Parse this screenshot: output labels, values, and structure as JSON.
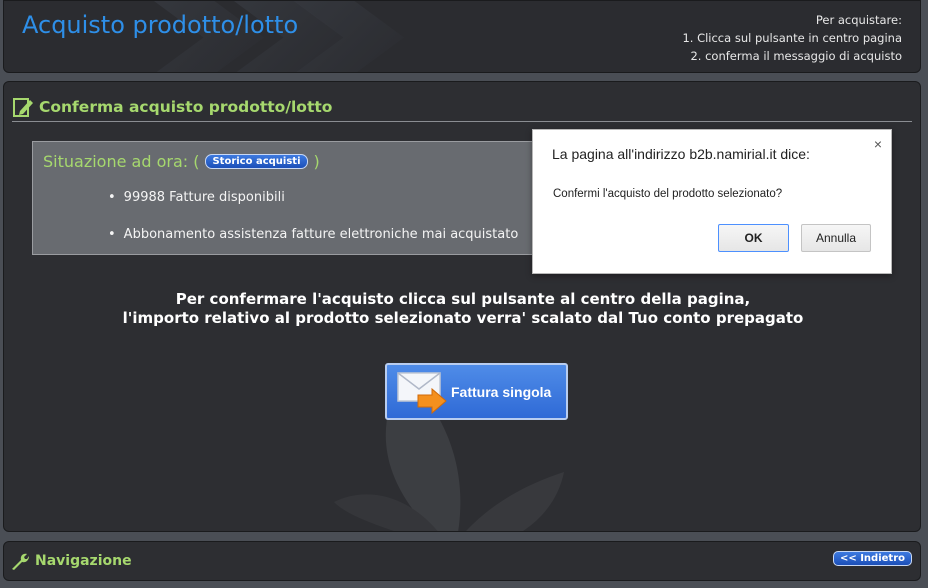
{
  "header": {
    "title": "Acquisto prodotto/lotto",
    "instructions_title": "Per acquistare:",
    "instruction_1": "1. Clicca sul pulsante in centro pagina",
    "instruction_2": "2. conferma il messaggio di acquisto"
  },
  "section": {
    "title": "Conferma acquisto prodotto/lotto",
    "icon": "edit-document-icon"
  },
  "status": {
    "title_prefix": "Situazione ad ora: (",
    "history_button": "Storico acquisti",
    "title_suffix": ")",
    "items": [
      "99988 Fatture disponibili",
      "Abbonamento assistenza fatture elettroniche mai acquistato"
    ]
  },
  "confirm": {
    "line1": "Per confermare l'acquisto clicca sul pulsante al centro della pagina,",
    "line2": "l'importo relativo al prodotto selezionato verra' scalato dal Tuo conto prepagato"
  },
  "invoice_button": {
    "label": "Fattura singola",
    "icon": "envelope-arrow-icon"
  },
  "footer": {
    "nav_label": "Navigazione",
    "nav_icon": "wrench-icon",
    "back_button": "<< Indietro"
  },
  "dialog": {
    "title": "La pagina all'indirizzo b2b.namirial.it dice:",
    "close": "×",
    "message": "Confermi l'acquisto del prodotto selezionato?",
    "ok": "OK",
    "cancel": "Annulla"
  },
  "colors": {
    "accent_blue": "#2e8fe8",
    "accent_green": "#a6d86e",
    "panel_dark": "#2d2e32",
    "background": "#4a4e55"
  }
}
